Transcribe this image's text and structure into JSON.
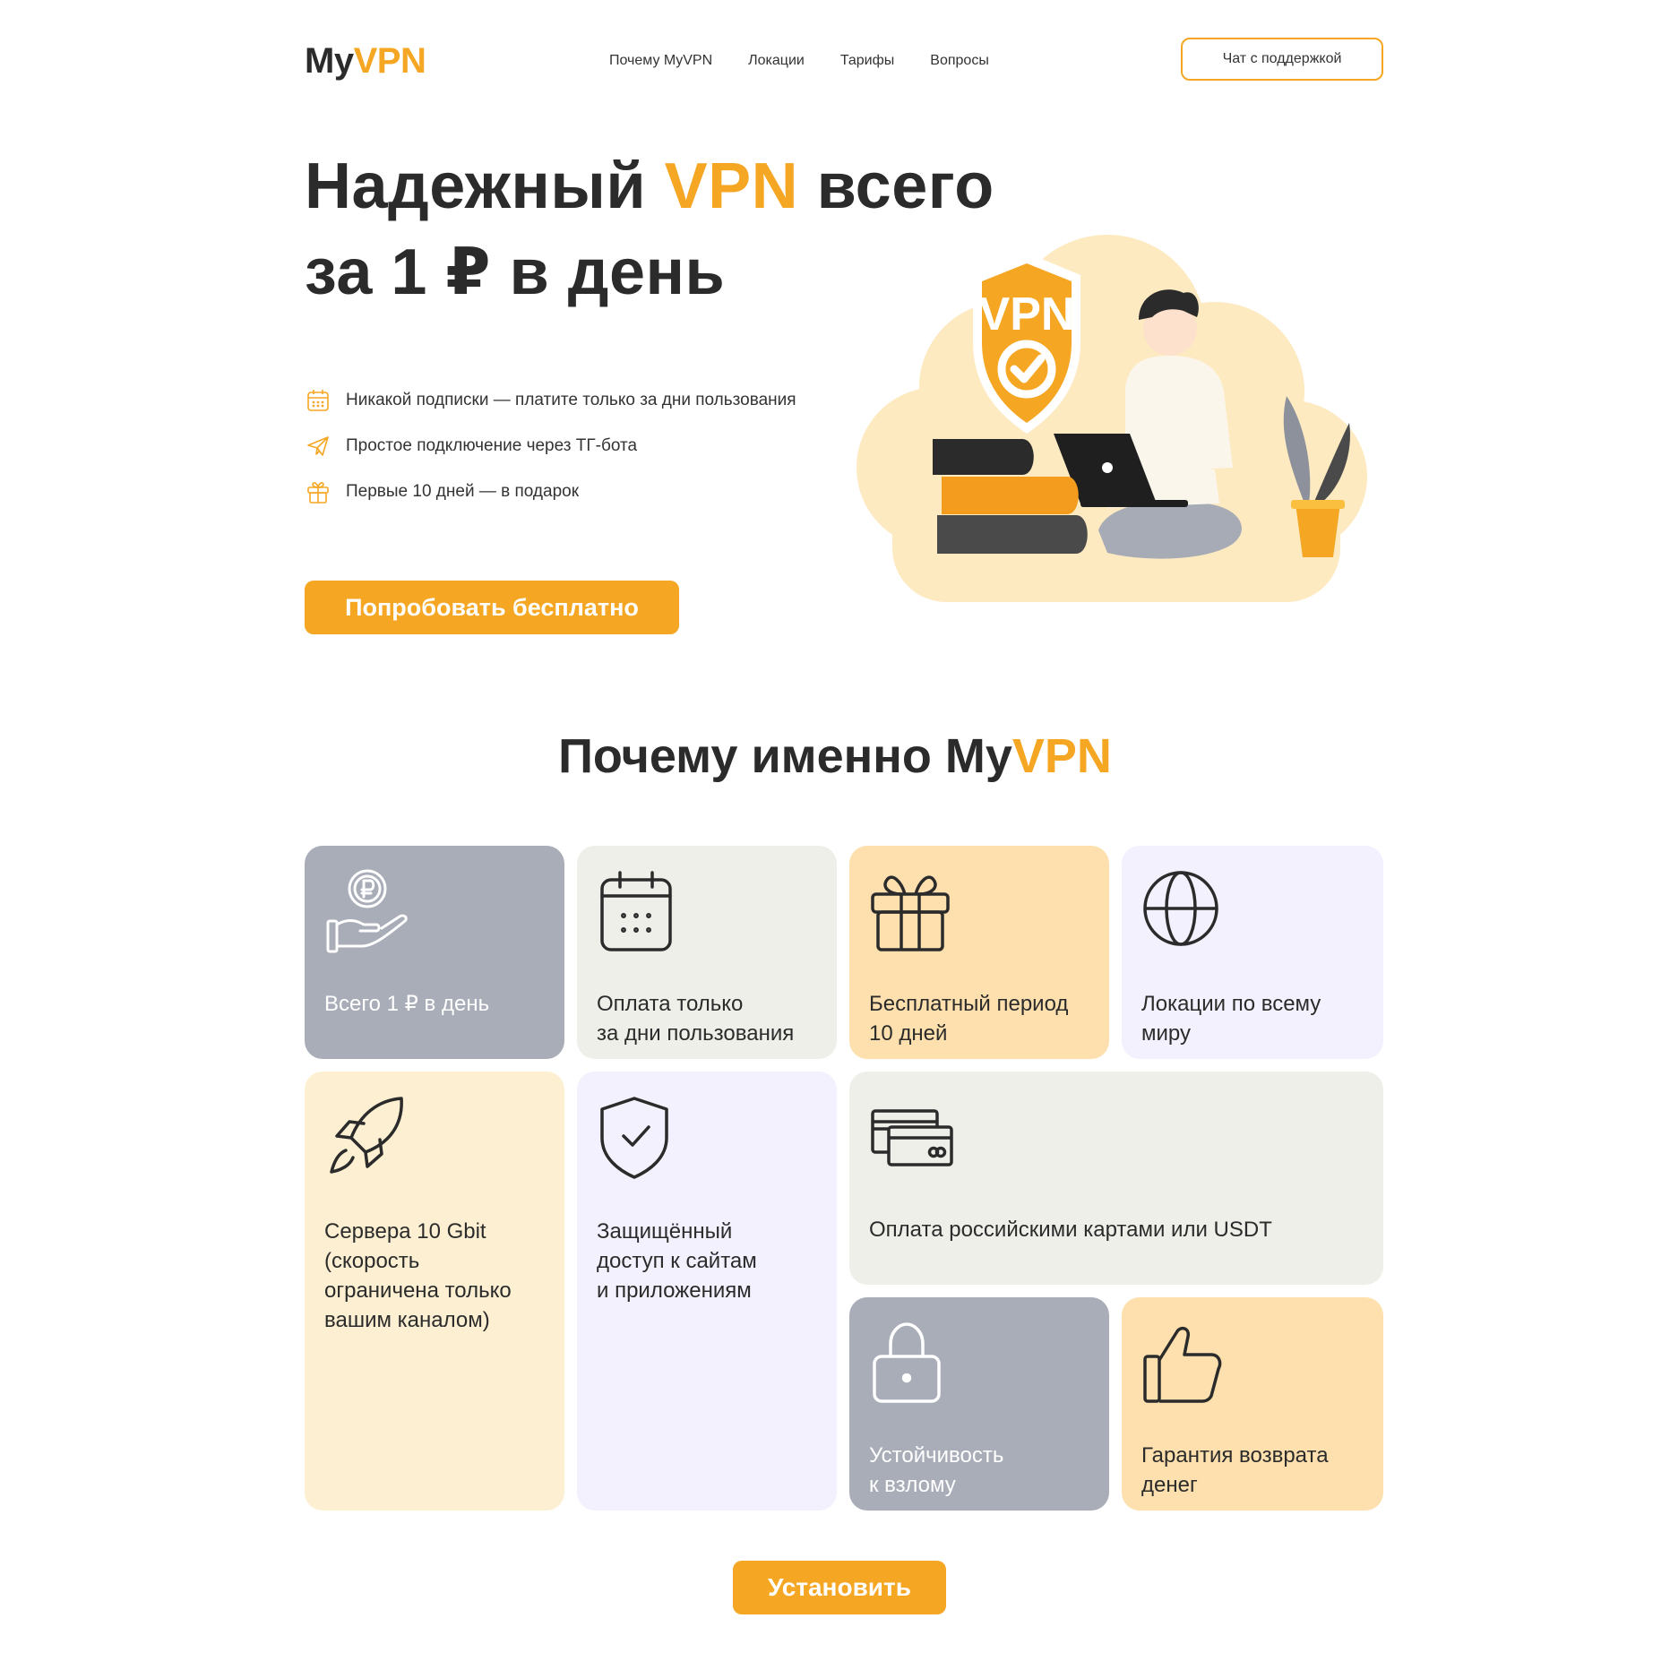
{
  "header": {
    "logo_my": "My",
    "logo_vpn": "VPN",
    "nav": [
      "Почему MyVPN",
      "Локации",
      "Тарифы",
      "Вопросы"
    ],
    "support_label": "Чат с поддержкой"
  },
  "hero": {
    "title_part1": "Надежный ",
    "title_accent": "VPN",
    "title_part2": " всего",
    "title_line2": "за 1 ₽ в день",
    "features": [
      {
        "icon": "calendar-icon",
        "text": "Никакой подписки — платите только за дни пользования"
      },
      {
        "icon": "paper-plane-icon",
        "text": "Простое подключение через ТГ-бота"
      },
      {
        "icon": "gift-icon",
        "text": "Первые 10 дней — в подарок"
      }
    ],
    "cta_label": "Попробовать бесплатно",
    "illustration_badge": "VPN"
  },
  "why": {
    "title_part1": "Почему именно My",
    "title_accent": "VPN",
    "cards": [
      {
        "icon": "coin-hand-icon",
        "line1": "Всего 1 ₽ в день",
        "line2": "",
        "line3": "",
        "line4": ""
      },
      {
        "icon": "calendar-icon",
        "line1": "Оплата только",
        "line2": "за дни пользования",
        "line3": "",
        "line4": ""
      },
      {
        "icon": "gift-icon",
        "line1": "Бесплатный период",
        "line2": "10 дней",
        "line3": "",
        "line4": ""
      },
      {
        "icon": "globe-icon",
        "line1": "Локации по всему",
        "line2": "миру",
        "line3": "",
        "line4": ""
      },
      {
        "icon": "rocket-icon",
        "line1": "Сервера 10 Gbit",
        "line2": "(скорость",
        "line3": "ограничена только",
        "line4": "вашим каналом)"
      },
      {
        "icon": "shield-check-icon",
        "line1": "Защищённый",
        "line2": "доступ к сайтам",
        "line3": "и приложениям",
        "line4": ""
      },
      {
        "icon": "cards-icon",
        "line1": "Оплата российскими картами или USDT",
        "line2": "",
        "line3": "",
        "line4": ""
      },
      {
        "icon": "lock-icon",
        "line1": "Устойчивость",
        "line2": "к взлому",
        "line3": "",
        "line4": ""
      },
      {
        "icon": "thumbs-up-icon",
        "line1": "Гарантия возврата",
        "line2": "денег",
        "line3": "",
        "line4": ""
      }
    ]
  },
  "install_label": "Установить",
  "colors": {
    "accent": "#f5a623",
    "text": "#2b2b2b",
    "card_gray": "#a9adb8",
    "card_offwhite": "#efefea",
    "card_peach": "#fde0ae",
    "card_lavender": "#f3f1fd",
    "card_cream": "#fdf0d2"
  }
}
